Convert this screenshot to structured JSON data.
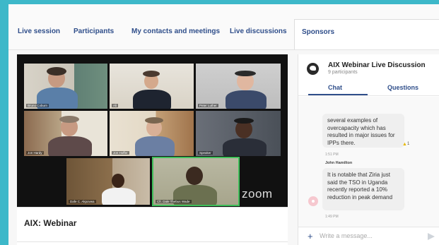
{
  "nav": {
    "items": [
      {
        "label": "Live session"
      },
      {
        "label": "Participants"
      },
      {
        "label": "My contacts and meetings"
      },
      {
        "label": "Live discussions"
      },
      {
        "label": "Sponsors"
      }
    ]
  },
  "video": {
    "zoom_logo": "zoom",
    "tiles": [
      {
        "name": "Bruno Coburn"
      },
      {
        "name": "Ali"
      },
      {
        "name": "Peter Luther"
      },
      {
        "name": "Jon Hardy"
      },
      {
        "name": "Jon Hoffer"
      },
      {
        "name": "Speaker"
      },
      {
        "name": "Dafe C. Akpovwa"
      },
      {
        "name": "Cfr. Dale Thebus Wade"
      }
    ]
  },
  "webinar": {
    "title": "AIX: Webinar"
  },
  "chat": {
    "title": "AIX Webinar Live Discussion",
    "participants": "9 participants",
    "tabs": [
      {
        "label": "Chat"
      },
      {
        "label": "Questions"
      }
    ],
    "messages": [
      {
        "text": "several examples of overcapacity which has resulted in major issues for IPPs there.",
        "time": "1:51 PM",
        "likes": "1"
      },
      {
        "sender": "John Hamilton",
        "text": "It is notable that Ziria just said the TSO in Uganda recently reported a 10% reduction in peak demand",
        "time": "1:49 PM"
      }
    ],
    "input_placeholder": "Write a message..."
  },
  "colors": {
    "brand": "#2f4e8a",
    "background": "#3db8c9",
    "active_speaker": "#3fbf5a"
  },
  "icons": {
    "chat_avatar": "chat-bubble-icon",
    "like": "thumbs-up-icon",
    "add": "plus-icon",
    "send": "send-icon"
  }
}
